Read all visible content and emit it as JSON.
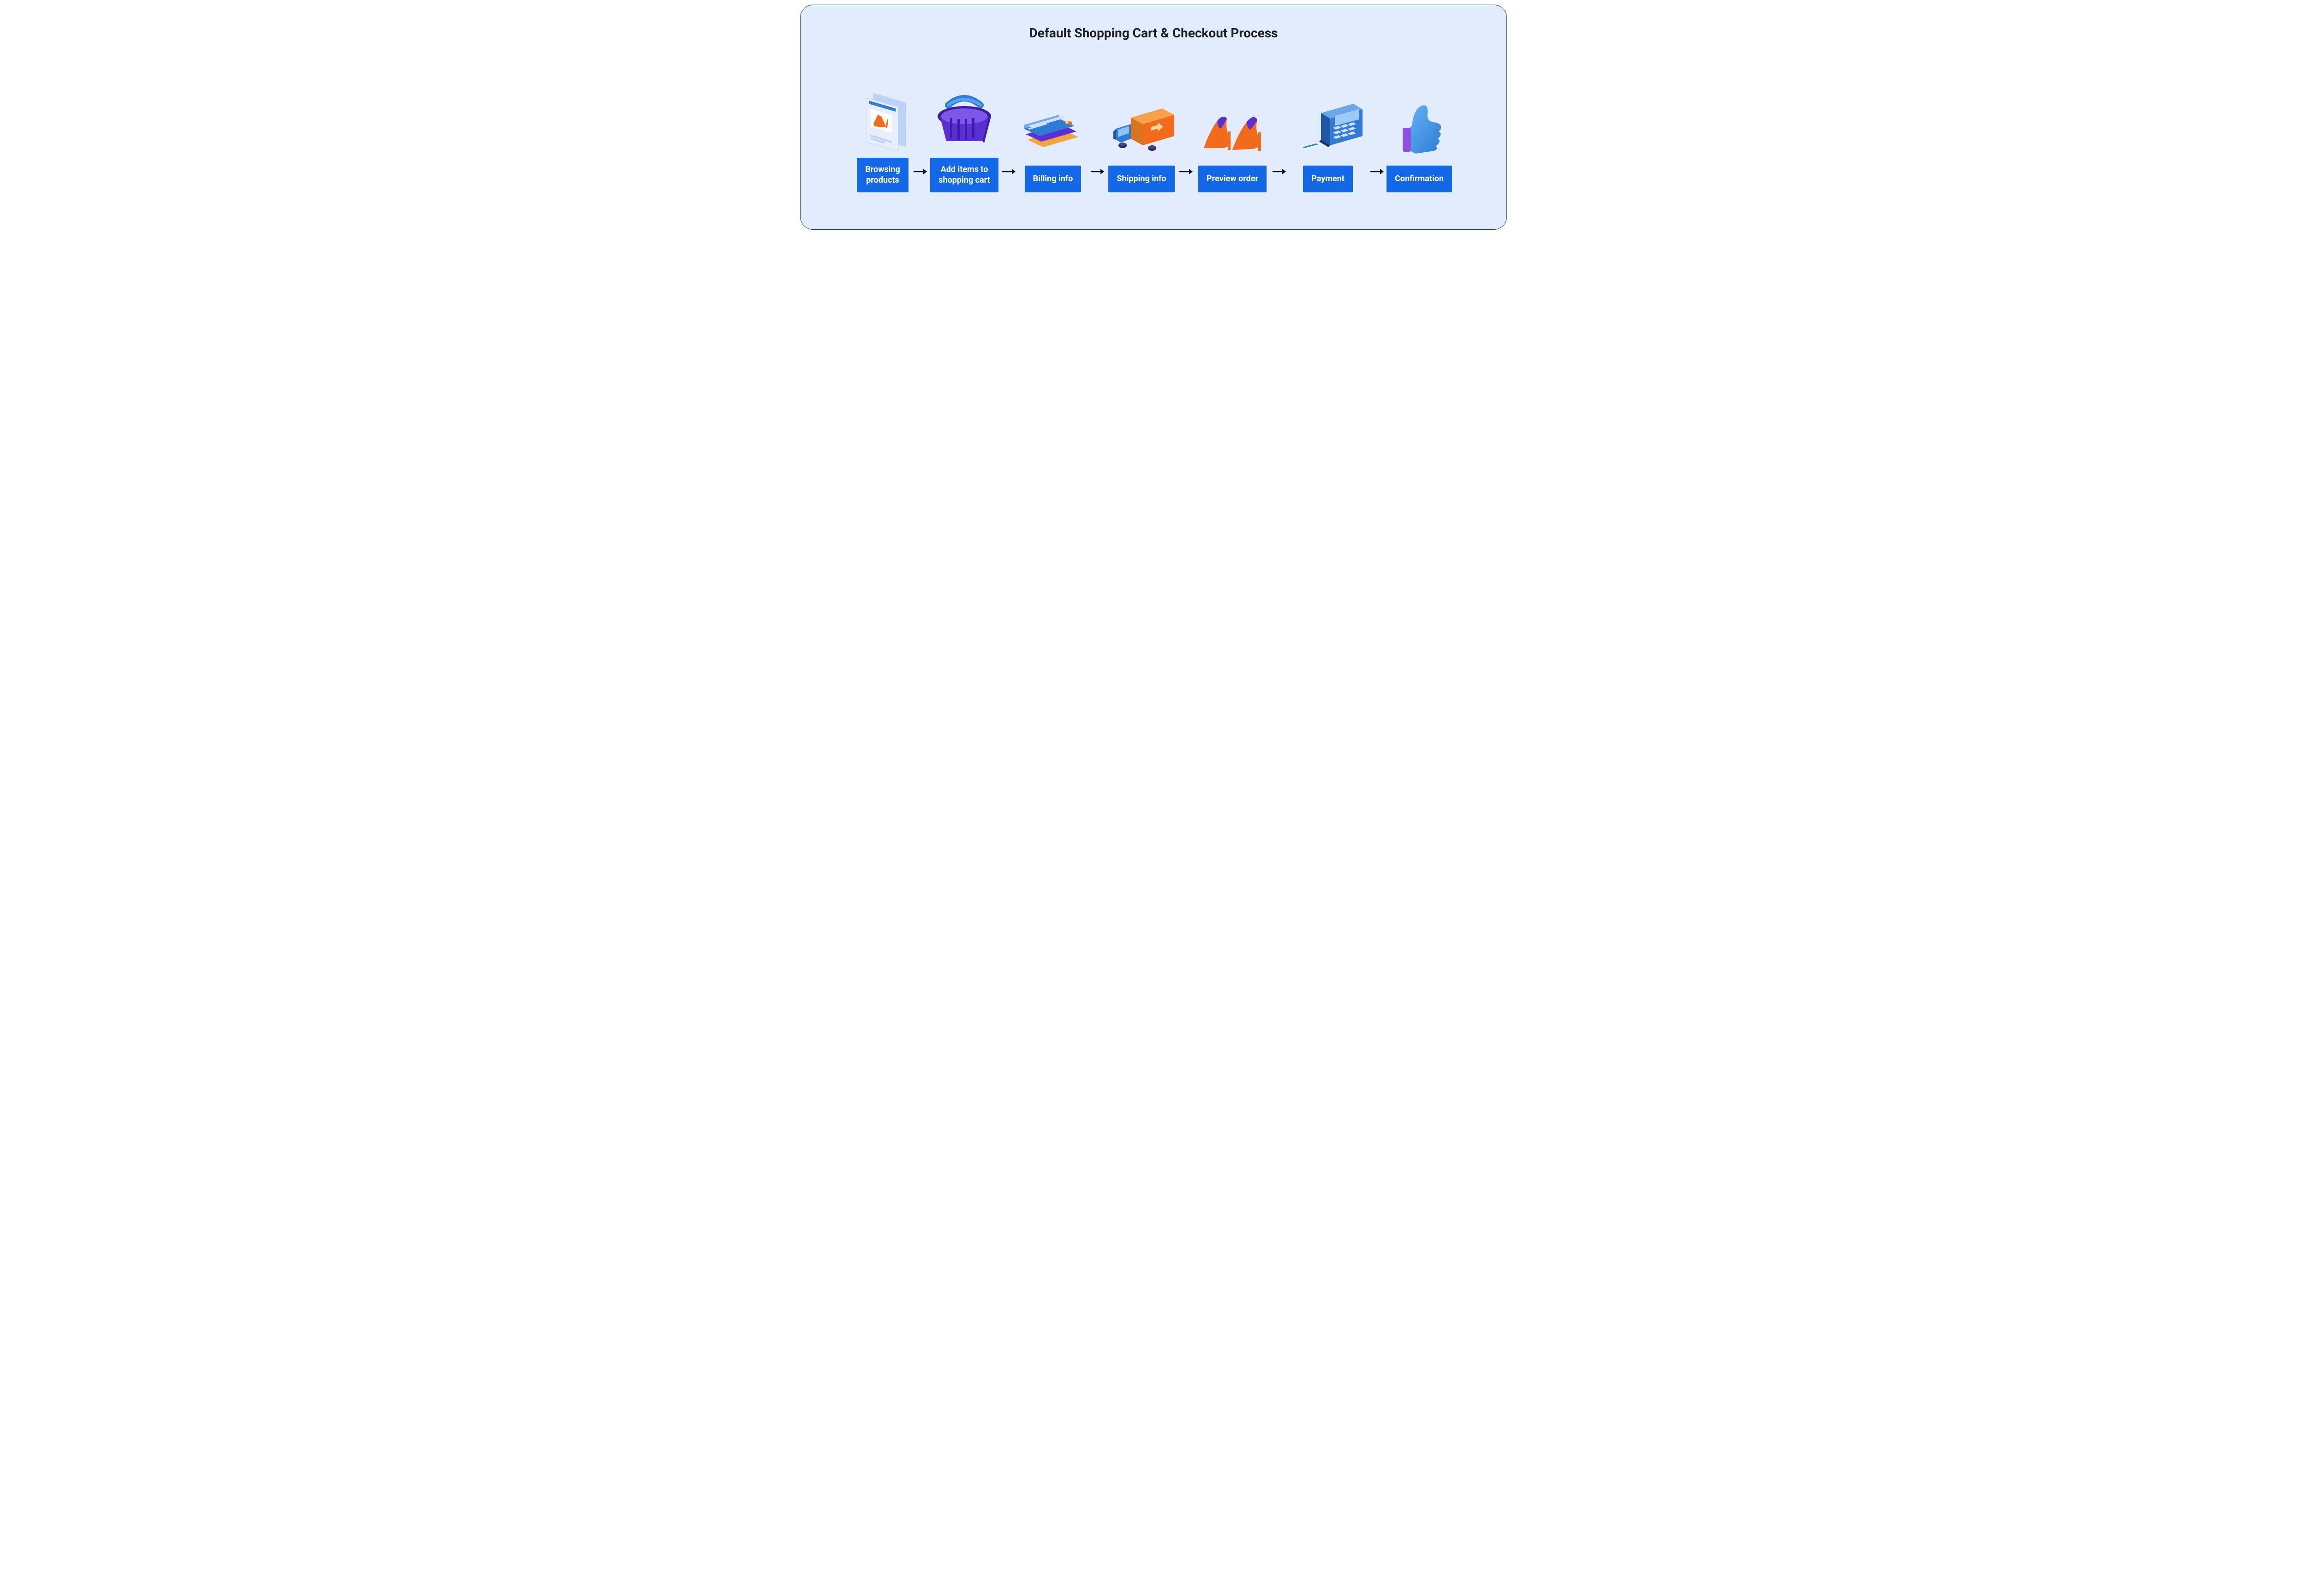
{
  "title": "Default Shopping Cart & Checkout Process",
  "steps": [
    {
      "label": "Browsing\nproducts",
      "icon": "product-page-icon"
    },
    {
      "label": "Add items to\nshopping cart",
      "icon": "shopping-basket-icon"
    },
    {
      "label": "Billing info",
      "icon": "credit-cards-icon"
    },
    {
      "label": "Shipping info",
      "icon": "delivery-truck-icon"
    },
    {
      "label": "Preview order",
      "icon": "high-heels-icon"
    },
    {
      "label": "Payment",
      "icon": "payment-terminal-icon"
    },
    {
      "label": "Confirmation",
      "icon": "thumbs-up-icon"
    }
  ],
  "colors": {
    "card_bg": "#e2ecfc",
    "label_bg": "#1268e6",
    "title": "#1b1f24",
    "accent_orange": "#f26a1b",
    "accent_purple": "#5b2fd3",
    "accent_blue": "#2f7bd6"
  }
}
